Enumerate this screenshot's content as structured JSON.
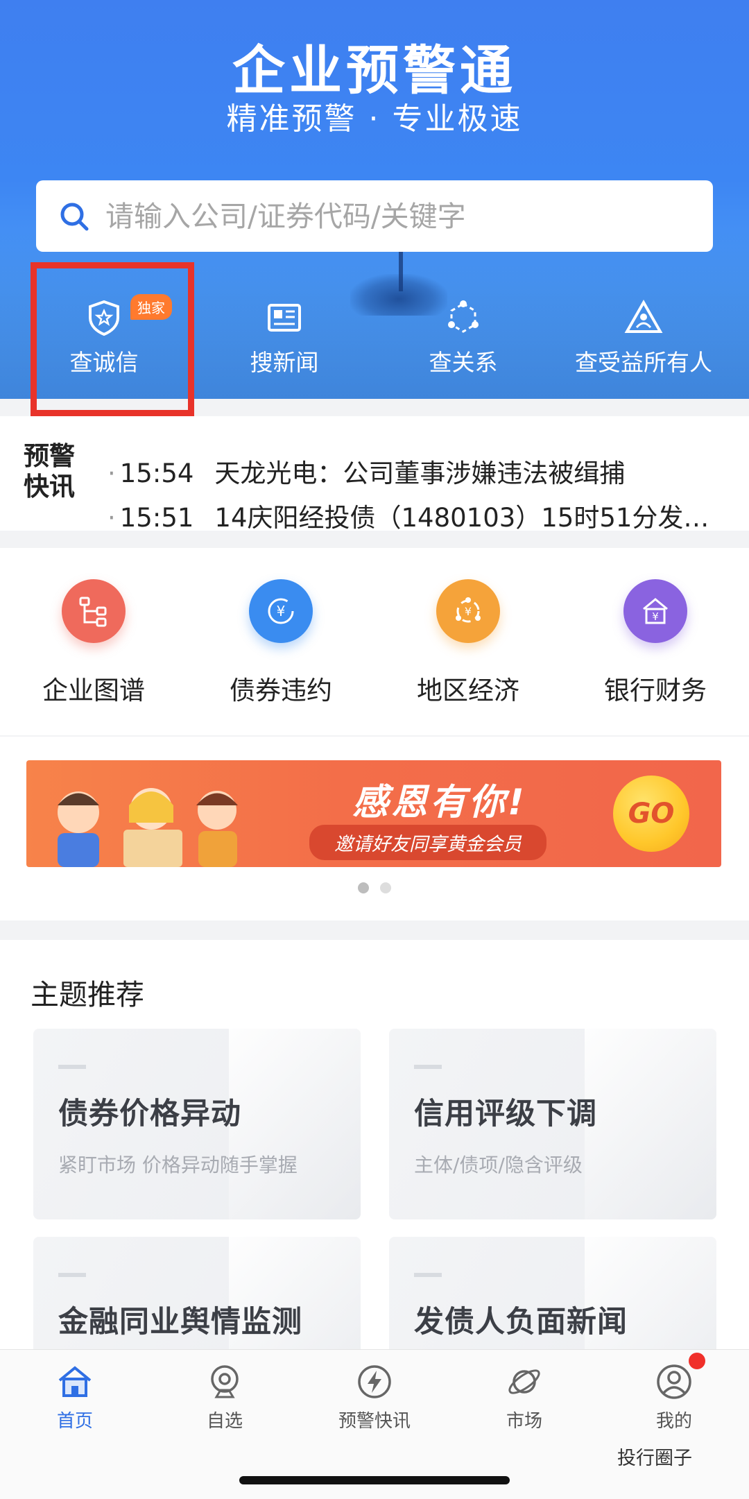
{
  "header": {
    "title": "企业预警通",
    "subtitle": "精准预警 · 专业极速",
    "search_placeholder": "请输入公司/证券代码/关键字"
  },
  "quick_actions": [
    {
      "label": "查诚信",
      "icon": "shield-star-icon",
      "badge": "独家"
    },
    {
      "label": "搜新闻",
      "icon": "newspaper-icon"
    },
    {
      "label": "查关系",
      "icon": "network-icon"
    },
    {
      "label": "查受益所有人",
      "icon": "triangle-person-icon"
    }
  ],
  "news": {
    "tag_line1": "预警",
    "tag_line2_a": "快",
    "tag_line2_b": "讯",
    "items": [
      {
        "time": "15:54",
        "text": "天龙光电：公司董事涉嫌违法被缉捕"
      },
      {
        "time": "15:51",
        "text": "14庆阳经投债（1480103）15时51分发…"
      }
    ]
  },
  "functions": [
    {
      "label": "企业图谱",
      "icon": "org-chart-icon",
      "color": "#ef6a5c"
    },
    {
      "label": "债券违约",
      "icon": "yen-refresh-icon",
      "color": "#3a8cf0"
    },
    {
      "label": "地区经济",
      "icon": "yen-people-icon",
      "color": "#f5a33a"
    },
    {
      "label": "银行财务",
      "icon": "bank-yen-icon",
      "color": "#8a63e0"
    }
  ],
  "banner": {
    "title": "感恩有你!",
    "subtitle": "邀请好友同享黄金会员",
    "go_label": "GO"
  },
  "topics": {
    "heading": "主题推荐",
    "cards": [
      {
        "title": "债券价格异动",
        "desc": "紧盯市场 价格异动随手掌握"
      },
      {
        "title": "信用评级下调",
        "desc": "主体/债项/隐含评级"
      },
      {
        "title": "金融同业舆情监测",
        "desc": ""
      },
      {
        "title": "发债人负面新闻",
        "desc": ""
      }
    ]
  },
  "tabbar": [
    {
      "label": "首页",
      "icon": "home-icon",
      "active": true
    },
    {
      "label": "自选",
      "icon": "webcam-icon"
    },
    {
      "label": "预警快讯",
      "icon": "lightning-icon"
    },
    {
      "label": "市场",
      "icon": "planet-icon"
    },
    {
      "label": "我的",
      "icon": "profile-icon"
    }
  ],
  "watermark": "投行圈子",
  "colors": {
    "brand_blue": "#3f7ff0",
    "highlight_red": "#e8332a",
    "badge_orange": "#ff7a2e",
    "tab_active": "#2f6fe4"
  }
}
